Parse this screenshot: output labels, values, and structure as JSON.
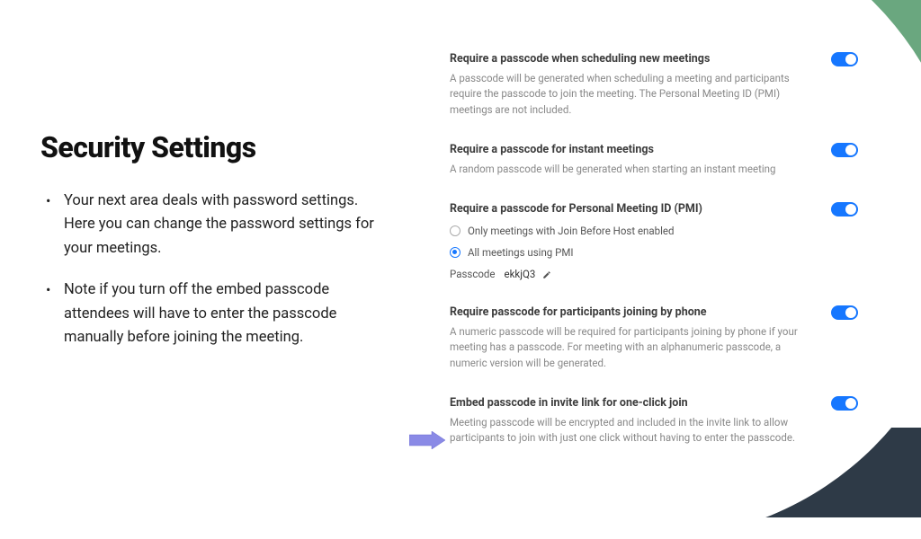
{
  "slide": {
    "title": "Security Settings",
    "bullets": [
      "Your next area deals with password settings. Here you can change the password settings for your meetings.",
      "Note if you turn off the embed passcode attendees will have to enter the passcode manually before joining the meeting."
    ]
  },
  "settings": [
    {
      "title": "Require a passcode when scheduling new meetings",
      "desc": "A passcode will be generated when scheduling a meeting and participants require the passcode to join the meeting. The Personal Meeting ID (PMI) meetings are not included.",
      "on": true
    },
    {
      "title": "Require a passcode for instant meetings",
      "desc": "A random passcode will be generated when starting an instant meeting",
      "on": true
    },
    {
      "title": "Require a passcode for Personal Meeting ID (PMI)",
      "desc": "",
      "on": true,
      "radios": [
        {
          "label": "Only meetings with Join Before Host enabled",
          "selected": false
        },
        {
          "label": "All meetings using PMI",
          "selected": true
        }
      ],
      "passcode": {
        "label": "Passcode",
        "value": "ekkjQ3"
      }
    },
    {
      "title": "Require passcode for participants joining by phone",
      "desc": "A numeric passcode will be required for participants joining by phone if your meeting has a passcode. For meeting with an alphanumeric passcode, a numeric version will be generated.",
      "on": true
    },
    {
      "title": "Embed passcode in invite link for one-click join",
      "desc": "Meeting passcode will be encrypted and included in the invite link to allow participants to join with just one click without having to enter the passcode.",
      "on": true
    }
  ]
}
